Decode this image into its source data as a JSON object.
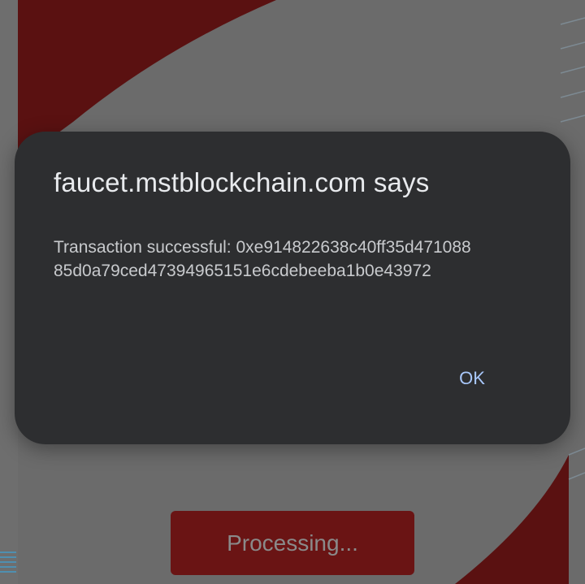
{
  "dialog": {
    "title": "faucet.mstblockchain.com says",
    "message_line1": "Transaction successful: 0xe914822638c40ff35d471088",
    "message_line2": "85d0a79ced47394965151e6cdebeeba1b0e43972",
    "ok_label": "OK"
  },
  "page": {
    "processing_label": "Processing..."
  },
  "colors": {
    "dialog_bg": "#2d2e30",
    "accent_red": "#6a1414",
    "ok_text": "#a8c7fa"
  }
}
